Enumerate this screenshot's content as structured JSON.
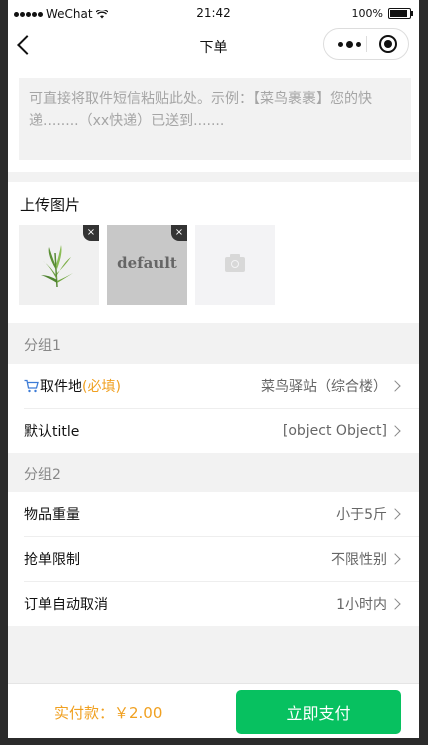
{
  "status_bar": {
    "carrier": "WeChat",
    "time": "21:42",
    "battery": "100%"
  },
  "nav": {
    "title": "下单"
  },
  "note": {
    "placeholder": "可直接将取件短信粘贴此处。示例：【菜鸟裹裹】您的快递........（xx快递）已送到......."
  },
  "upload": {
    "label": "上传图片",
    "placeholder_text": "default",
    "delete_symbol": "×"
  },
  "group1": {
    "title": "分组1",
    "rows": [
      {
        "label": "取件地",
        "required": "(必填)",
        "value": "菜鸟驿站（综合楼）"
      },
      {
        "label": "默认title",
        "value": "[object Object]"
      }
    ]
  },
  "group2": {
    "title": "分组2",
    "rows": [
      {
        "label": "物品重量",
        "value": "小于5斤"
      },
      {
        "label": "抢单限制",
        "value": "不限性别"
      },
      {
        "label": "订单自动取消",
        "value": "1小时内"
      }
    ]
  },
  "footer": {
    "price": "实付款：￥2.00",
    "pay_label": "立即支付"
  },
  "colors": {
    "accent": "#07c160",
    "highlight": "#f0a020",
    "cart_icon": "#3c7bd6"
  }
}
